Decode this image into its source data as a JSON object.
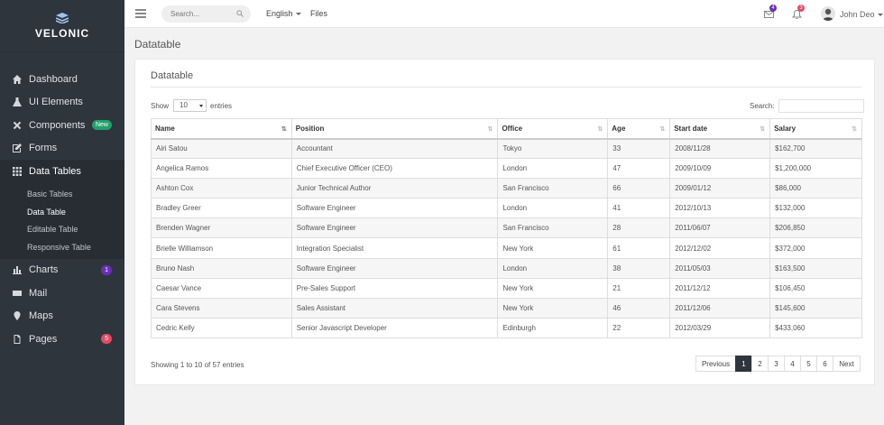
{
  "brand": {
    "name": "VELONIC"
  },
  "sidebar": {
    "items": [
      {
        "label": "Dashboard",
        "icon": "home-icon"
      },
      {
        "label": "UI Elements",
        "icon": "flask-icon"
      },
      {
        "label": "Components",
        "icon": "tools-icon",
        "badge": "New"
      },
      {
        "label": "Forms",
        "icon": "edit-icon"
      },
      {
        "label": "Data Tables",
        "icon": "grid-icon"
      },
      {
        "label": "Charts",
        "icon": "bar-chart-icon",
        "badge": "1"
      },
      {
        "label": "Mail",
        "icon": "mail-icon"
      },
      {
        "label": "Maps",
        "icon": "map-pin-icon"
      },
      {
        "label": "Pages",
        "icon": "file-icon",
        "badge": "5"
      }
    ],
    "subitems": [
      {
        "label": "Basic Tables"
      },
      {
        "label": "Data Table"
      },
      {
        "label": "Editable Table"
      },
      {
        "label": "Responsive Table"
      }
    ],
    "colors": {
      "bg": "#2f353d",
      "active_bg": "#282d34",
      "badge_green": "#22a16b",
      "badge_purple": "#6a2fb5",
      "badge_red": "#e44a64"
    }
  },
  "topbar": {
    "search_placeholder": "Search...",
    "language": "English",
    "files": "Files",
    "mail_count": "4",
    "notif_count": "3",
    "user_name": "John Deo"
  },
  "page": {
    "title": "Datatable"
  },
  "card": {
    "title": "Datatable",
    "show_label": "Show",
    "length_value": "10",
    "entries_label": "entries",
    "search_label": "Search:"
  },
  "table": {
    "headers": [
      "Name",
      "Position",
      "Office",
      "Age",
      "Start date",
      "Salary"
    ],
    "rows": [
      [
        "Airi Satou",
        "Accountant",
        "Tokyo",
        "33",
        "2008/11/28",
        "$162,700"
      ],
      [
        "Angelica Ramos",
        "Chief Executive Officer (CEO)",
        "London",
        "47",
        "2009/10/09",
        "$1,200,000"
      ],
      [
        "Ashton Cox",
        "Junior Technical Author",
        "San Francisco",
        "66",
        "2009/01/12",
        "$86,000"
      ],
      [
        "Bradley Greer",
        "Software Engineer",
        "London",
        "41",
        "2012/10/13",
        "$132,000"
      ],
      [
        "Brenden Wagner",
        "Software Engineer",
        "San Francisco",
        "28",
        "2011/06/07",
        "$206,850"
      ],
      [
        "Brielle Williamson",
        "Integration Specialist",
        "New York",
        "61",
        "2012/12/02",
        "$372,000"
      ],
      [
        "Bruno Nash",
        "Software Engineer",
        "London",
        "38",
        "2011/05/03",
        "$163,500"
      ],
      [
        "Caesar Vance",
        "Pre-Sales Support",
        "New York",
        "21",
        "2011/12/12",
        "$106,450"
      ],
      [
        "Cara Stevens",
        "Sales Assistant",
        "New York",
        "46",
        "2011/12/06",
        "$145,600"
      ],
      [
        "Cedric Kelly",
        "Senior Javascript Developer",
        "Edinburgh",
        "22",
        "2012/03/29",
        "$433,060"
      ]
    ]
  },
  "footer": {
    "info": "Showing 1 to 10 of 57 entries",
    "previous": "Previous",
    "pages": [
      "1",
      "2",
      "3",
      "4",
      "5",
      "6"
    ],
    "next": "Next"
  }
}
